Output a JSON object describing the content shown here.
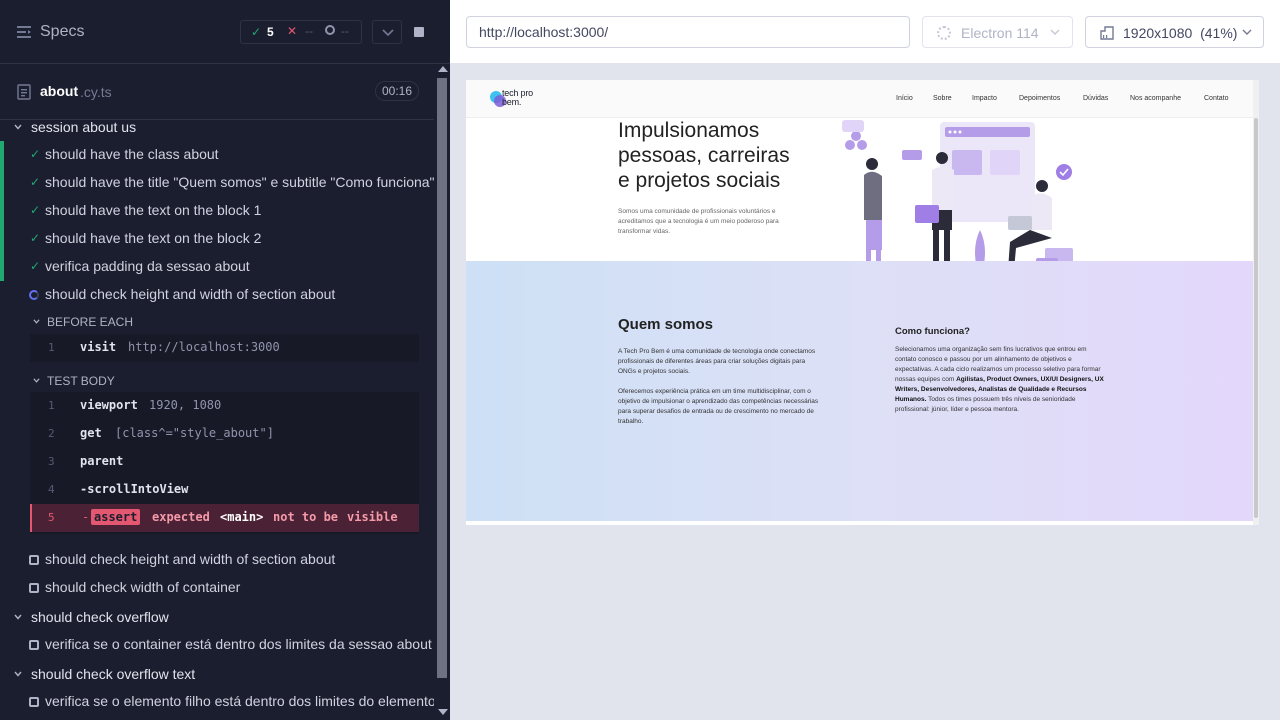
{
  "reporter": {
    "header": {
      "specs_label": "Specs",
      "passed": "5",
      "failed": "--",
      "pending": "--"
    },
    "file": {
      "name": "about",
      "ext": ".cy.ts",
      "timer": "00:16"
    },
    "suites": [
      {
        "title": "session about us"
      },
      {
        "title": "should check overflow"
      },
      {
        "title": "should check overflow text"
      }
    ],
    "tests": [
      {
        "label": "should have the class about",
        "state": "passed"
      },
      {
        "label": "should have the title \"Quem somos\" e subtitle \"Como funciona\"",
        "state": "passed"
      },
      {
        "label": "should have the text on the block 1",
        "state": "passed"
      },
      {
        "label": "should have the text on the block 2",
        "state": "passed"
      },
      {
        "label": "verifica padding da sessao about",
        "state": "passed"
      },
      {
        "label": "should check height and width of section about",
        "state": "running"
      },
      {
        "label": "should check height and width of section about",
        "state": "pending"
      },
      {
        "label": "should check width of container",
        "state": "pending"
      },
      {
        "label": "verifica se o container está dentro dos limites da sessao about",
        "state": "pending"
      },
      {
        "label": "verifica se o elemento filho está dentro dos limites do elemento pai",
        "state": "pending"
      }
    ],
    "hooks": {
      "before_each_label": "BEFORE EACH",
      "test_body_label": "TEST BODY",
      "before_each_cmds": [
        {
          "num": "1",
          "name": "visit",
          "arg": "http://localhost:3000"
        }
      ],
      "test_body_cmds": [
        {
          "num": "1",
          "name": "viewport",
          "arg": "1920, 1080"
        },
        {
          "num": "2",
          "name": "get",
          "arg": "[class^=\"style_about\"]"
        },
        {
          "num": "3",
          "name": "parent",
          "arg": ""
        },
        {
          "num": "4",
          "name": "-scrollIntoView",
          "arg": ""
        },
        {
          "num": "5",
          "name": "assert",
          "dash": "-",
          "err_a": "expected",
          "err_b": "<main>",
          "err_c": "not to be",
          "err_d": "visible"
        }
      ]
    }
  },
  "preview": {
    "url": "http://localhost:3000/",
    "browser": "Electron 114",
    "viewport": "1920x1080",
    "scale": "(41%)"
  },
  "site": {
    "logo_line1": "tech pro",
    "logo_line2": "bem.",
    "nav": [
      "Início",
      "Sobre",
      "Impacto",
      "Depoimentos",
      "Dúvidas",
      "Nos acompanhe",
      "Contato"
    ],
    "hero_title_lines": [
      "Impulsionamos",
      "pessoas, carreiras",
      "e projetos sociais"
    ],
    "hero_sub": "Somos uma comunidade de profissionais voluntários e acreditamos que a tecnologia é um meio poderoso para transformar vidas.",
    "quem_title": "Quem somos",
    "quem_p1": "A Tech Pro Bem é uma comunidade de tecnologia onde conectamos profissionais de diferentes áreas para criar soluções digitais para ONGs e projetos sociais.",
    "quem_p2": "Oferecemos experiência prática em um time multidisciplinar, com o objetivo de impulsionar o aprendizado das competências necessárias para superar desafios de entrada ou de crescimento no mercado de trabalho.",
    "como_title": "Como funciona?",
    "como_p_a": "Selecionamos uma organização sem fins lucrativos que entrou em contato conosco e passou por um alinhamento de objetivos e expectativas. A cada ciclo realizamos um processo seletivo para formar nossas equipes com ",
    "como_p_b": "Agilistas, Product Owners, UX/UI Designers, UX Writers, Desenvolvedores, Analistas de Qualidade e Recursos Humanos.",
    "como_p_c": " Todos os times possuem três níveis de senioridade profissional: júnior, líder e pessoa mentora."
  },
  "colors": {
    "pass": "#1fa971",
    "fail": "#e45770",
    "running": "#6470f3",
    "panel_bg": "#1b1e2e"
  }
}
